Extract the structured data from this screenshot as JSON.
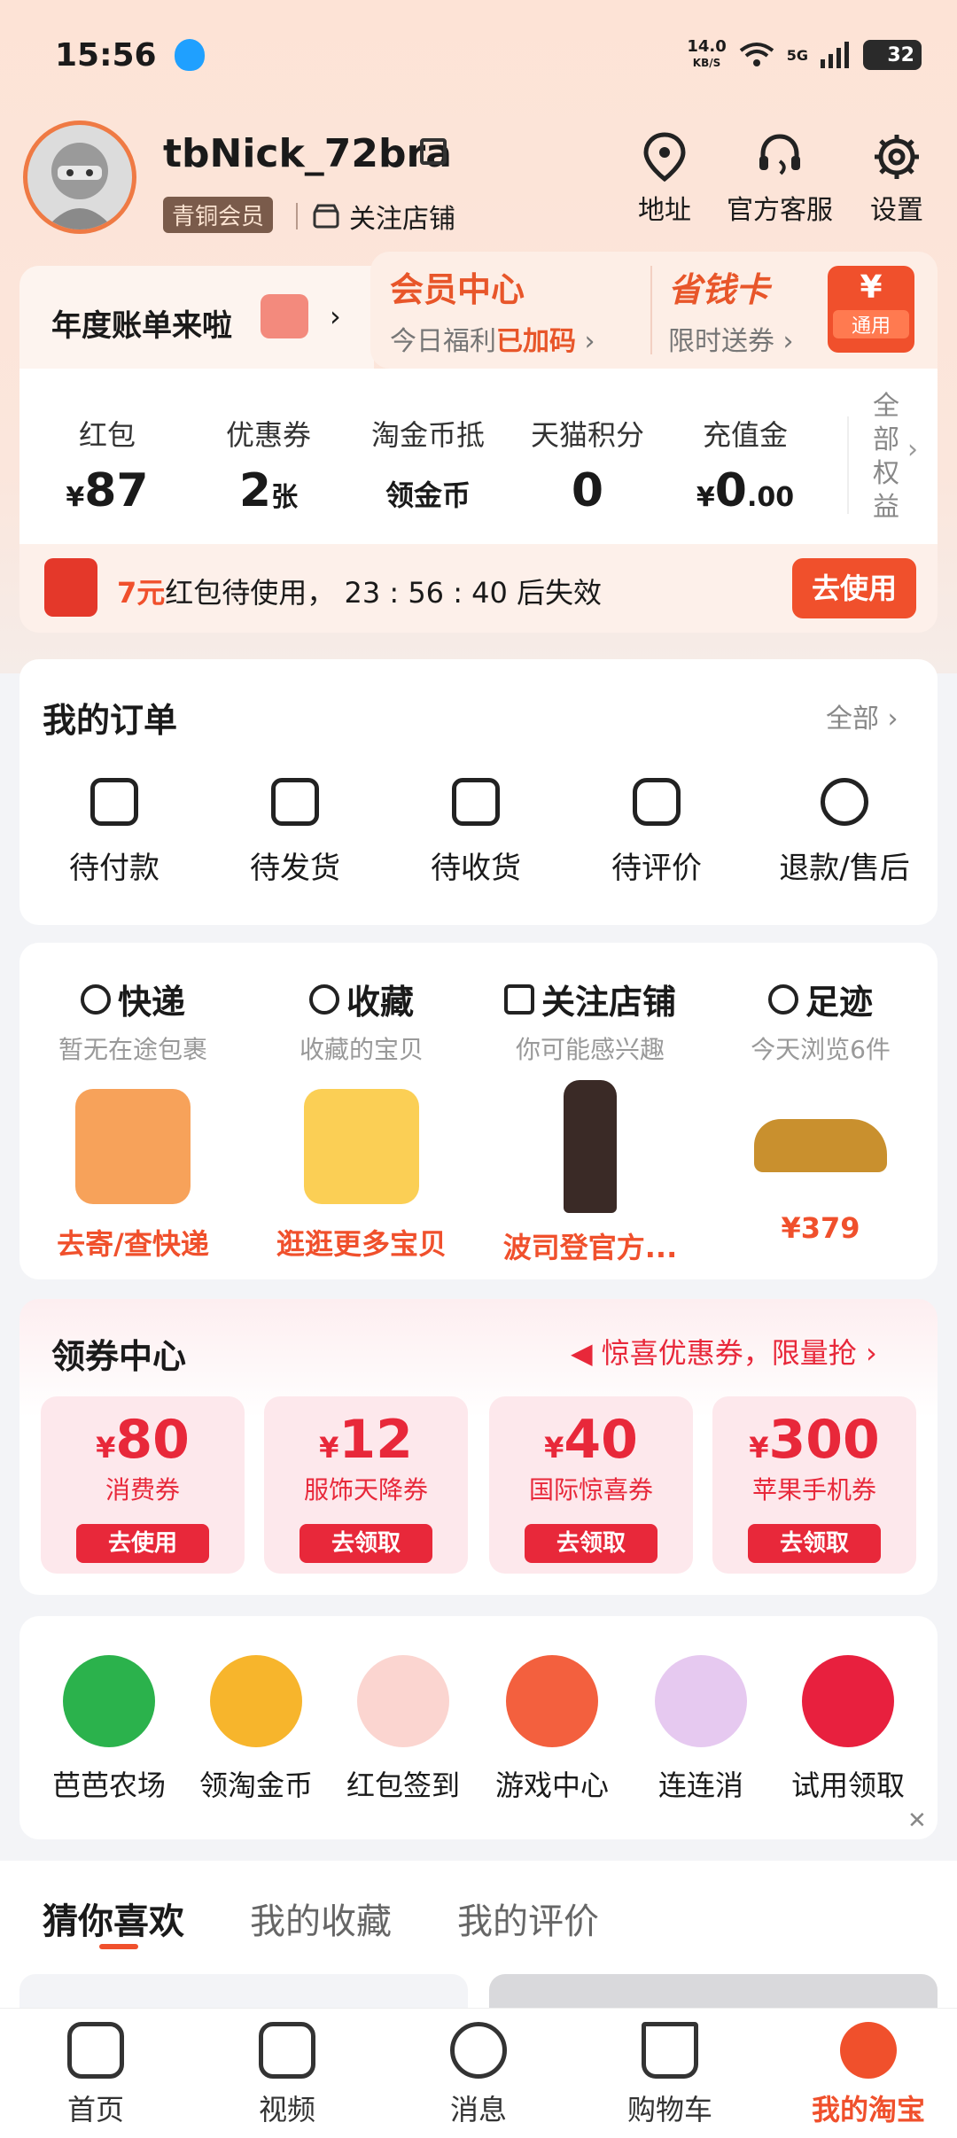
{
  "status": {
    "time": "15:56",
    "speed": "14.0",
    "speed_unit": "KB/S",
    "network": "5G",
    "battery": "32"
  },
  "profile": {
    "username": "tbNick_72bra",
    "level": "青铜会员",
    "follow_shops": "关注店铺",
    "actions": [
      "地址",
      "官方客服",
      "设置"
    ]
  },
  "banner": {
    "annual": "年度账单来啦",
    "vip_title": "会员中心",
    "vip_sub": "今日福利",
    "vip_sub_bold": "已加码",
    "money_title": "省钱卡",
    "money_sub": "限时送券",
    "badge_symbol": "¥",
    "badge_label": "通用"
  },
  "assets": {
    "items": [
      {
        "label": "红包",
        "prefix": "¥",
        "value": "87",
        "suffix": ""
      },
      {
        "label": "优惠券",
        "prefix": "",
        "value": "2",
        "suffix": "张"
      },
      {
        "label": "淘金币抵",
        "text": "领金币"
      },
      {
        "label": "天猫积分",
        "prefix": "",
        "value": "0",
        "suffix": ""
      },
      {
        "label": "充值金",
        "prefix": "¥",
        "value": "0",
        "suffix": ".00"
      }
    ],
    "all_rights": "全部权益"
  },
  "redpacket": {
    "amount": "7元",
    "text": "红包待使用，",
    "countdown": "23 : 56 : 40",
    "expire": "后失效",
    "button": "去使用"
  },
  "orders": {
    "title": "我的订单",
    "all": "全部",
    "items": [
      "待付款",
      "待发货",
      "待收货",
      "待评价",
      "退款/售后"
    ]
  },
  "shortcuts": [
    {
      "title": "快递",
      "sub": "暂无在途包裹",
      "action": "去寄/查快递"
    },
    {
      "title": "收藏",
      "sub": "收藏的宝贝",
      "action": "逛逛更多宝贝"
    },
    {
      "title": "关注店铺",
      "sub": "你可能感兴趣",
      "action": "波司登官方..."
    },
    {
      "title": "足迹",
      "sub": "今天浏览6件",
      "action": "¥379"
    }
  ],
  "coupons": {
    "title": "领券中心",
    "promo": "惊喜优惠券，限量抢",
    "items": [
      {
        "symbol": "¥",
        "amount": "80",
        "name": "消费券",
        "button": "去使用"
      },
      {
        "symbol": "¥",
        "amount": "12",
        "name": "服饰天降券",
        "button": "去领取"
      },
      {
        "symbol": "¥",
        "amount": "40",
        "name": "国际惊喜券",
        "button": "去领取"
      },
      {
        "symbol": "¥",
        "amount": "300",
        "name": "苹果手机券",
        "button": "去领取"
      }
    ]
  },
  "apps": [
    "芭芭农场",
    "领淘金币",
    "红包签到",
    "游戏中心",
    "连连消",
    "试用领取"
  ],
  "feed_tabs": [
    "猜你喜欢",
    "我的收藏",
    "我的评价"
  ],
  "nav": [
    "首页",
    "视频",
    "消息",
    "购物车",
    "我的淘宝"
  ],
  "colors": {
    "accent": "#f0502c",
    "coupon_red": "#e8283a",
    "header_bg": "#fde3d6"
  }
}
